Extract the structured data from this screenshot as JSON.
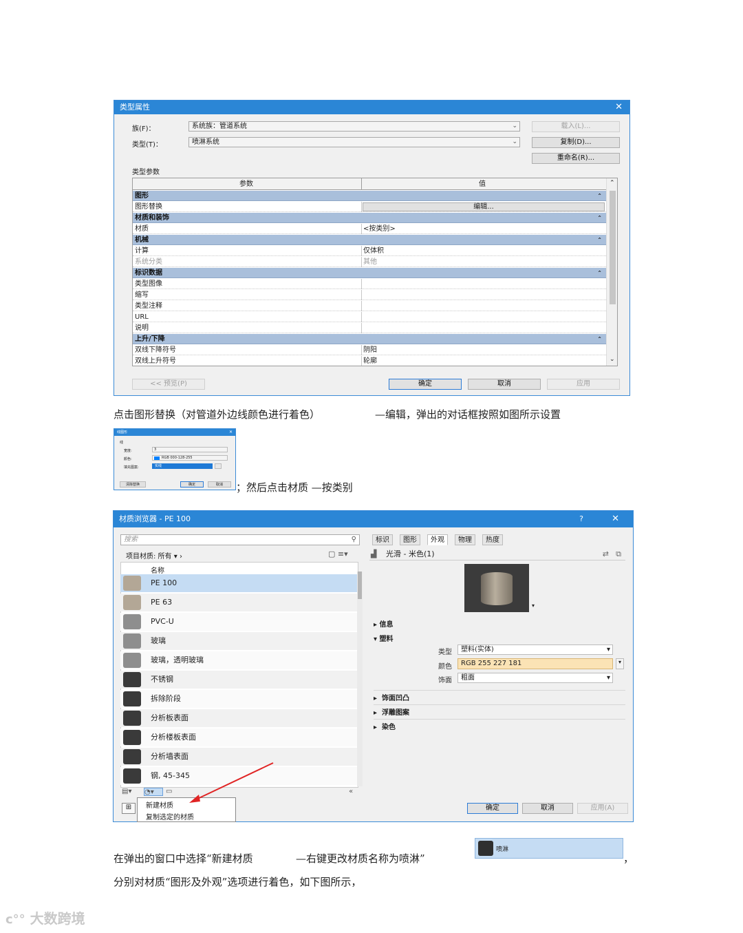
{
  "type_props": {
    "title": "类型属性",
    "family_label": "族(F)：",
    "family_value": "系统族：管道系统",
    "type_label": "类型(T)：",
    "type_value": "喷淋系统",
    "load_btn": "载入(L)...",
    "dup_btn": "复制(D)...",
    "rename_btn": "重命名(R)...",
    "params_label": "类型参数",
    "col_param": "参数",
    "col_value": "值",
    "rows": [
      {
        "kind": "group",
        "param": "图形"
      },
      {
        "kind": "row",
        "param": "图形替换",
        "value": "编辑..."
      },
      {
        "kind": "group",
        "param": "材质和装饰"
      },
      {
        "kind": "row",
        "param": "材质",
        "value": "<按类别>"
      },
      {
        "kind": "group",
        "param": "机械"
      },
      {
        "kind": "row",
        "param": "计算",
        "value": "仅体积"
      },
      {
        "kind": "gray",
        "param": "系统分类",
        "value": "其他"
      },
      {
        "kind": "group",
        "param": "标识数据"
      },
      {
        "kind": "row",
        "param": "类型图像",
        "value": ""
      },
      {
        "kind": "row",
        "param": "缩写",
        "value": ""
      },
      {
        "kind": "row",
        "param": "类型注释",
        "value": ""
      },
      {
        "kind": "row",
        "param": "URL",
        "value": ""
      },
      {
        "kind": "row",
        "param": "说明",
        "value": ""
      },
      {
        "kind": "group",
        "param": "上升/下降"
      },
      {
        "kind": "row",
        "param": "双线下降符号",
        "value": "阴阳"
      },
      {
        "kind": "row",
        "param": "双线上升符号",
        "value": "轮廓"
      }
    ],
    "preview_btn": "<< 预览(P)",
    "ok_btn": "确定",
    "cancel_btn": "取消",
    "apply_btn": "应用"
  },
  "para1": {
    "left": "点击图形替换（对管道外边线颜色进行着色）",
    "right": "—编辑，弹出的对话框按照如图所示设置"
  },
  "small_dialog": {
    "title": "线图形",
    "group": "线",
    "l1": "宽度:",
    "v1": "3",
    "l2": "颜色:",
    "v2": "RGB 000-128-255",
    "l3": "填充图案:",
    "v3": "实线",
    "b1": "清除替换",
    "b2": "确定",
    "b3": "取消"
  },
  "para2": "；然后点击材质 —按类别",
  "mat_browser": {
    "title": "材质浏览器 - PE 100",
    "help": "?",
    "search_placeholder": "搜索",
    "filter": "项目材质: 所有",
    "col_name": "名称",
    "materials": [
      "PE 100",
      "PE 63",
      "PVC-U",
      "玻璃",
      "玻璃，透明玻璃",
      "不锈钢",
      "拆除阶段",
      "分析板表面",
      "分析楼板表面",
      "分析墙表面",
      "钢, 45-345"
    ],
    "colors": {
      "light": "#b3a796",
      "gray": "#8e8e8e",
      "dark": "#3a3a3a",
      "selected": "#c5dcf3",
      "orange": "#fbe3b5"
    },
    "menu_new": "新建材质",
    "menu_copy": "复制选定的材质",
    "tabs": [
      "标识",
      "图形",
      "外观",
      "物理",
      "热度"
    ],
    "asset_name": "光滑 - 米色(1)",
    "sec_info": "信息",
    "sec_plastic": "塑料",
    "prop_type_l": "类型",
    "prop_type_v": "塑料(实体)",
    "prop_color_l": "颜色",
    "prop_color_v": "RGB 255 227 181",
    "prop_finish_l": "饰面",
    "prop_finish_v": "粗面",
    "sec_bump": "饰面凹凸",
    "sec_relief": "浮雕图案",
    "sec_tint": "染色",
    "ok_btn": "确定",
    "cancel_btn": "取消",
    "apply_btn": "应用(A)"
  },
  "para3": {
    "left": "在弹出的窗口中选择“新建材质",
    "mid": "—右键更改材质名称为喷淋”",
    "strip_label": "喷淋",
    "comma": "，"
  },
  "para4": "分别对材质“图形及外观”选项进行着色，如下图所示，",
  "watermark": "大数跨境"
}
